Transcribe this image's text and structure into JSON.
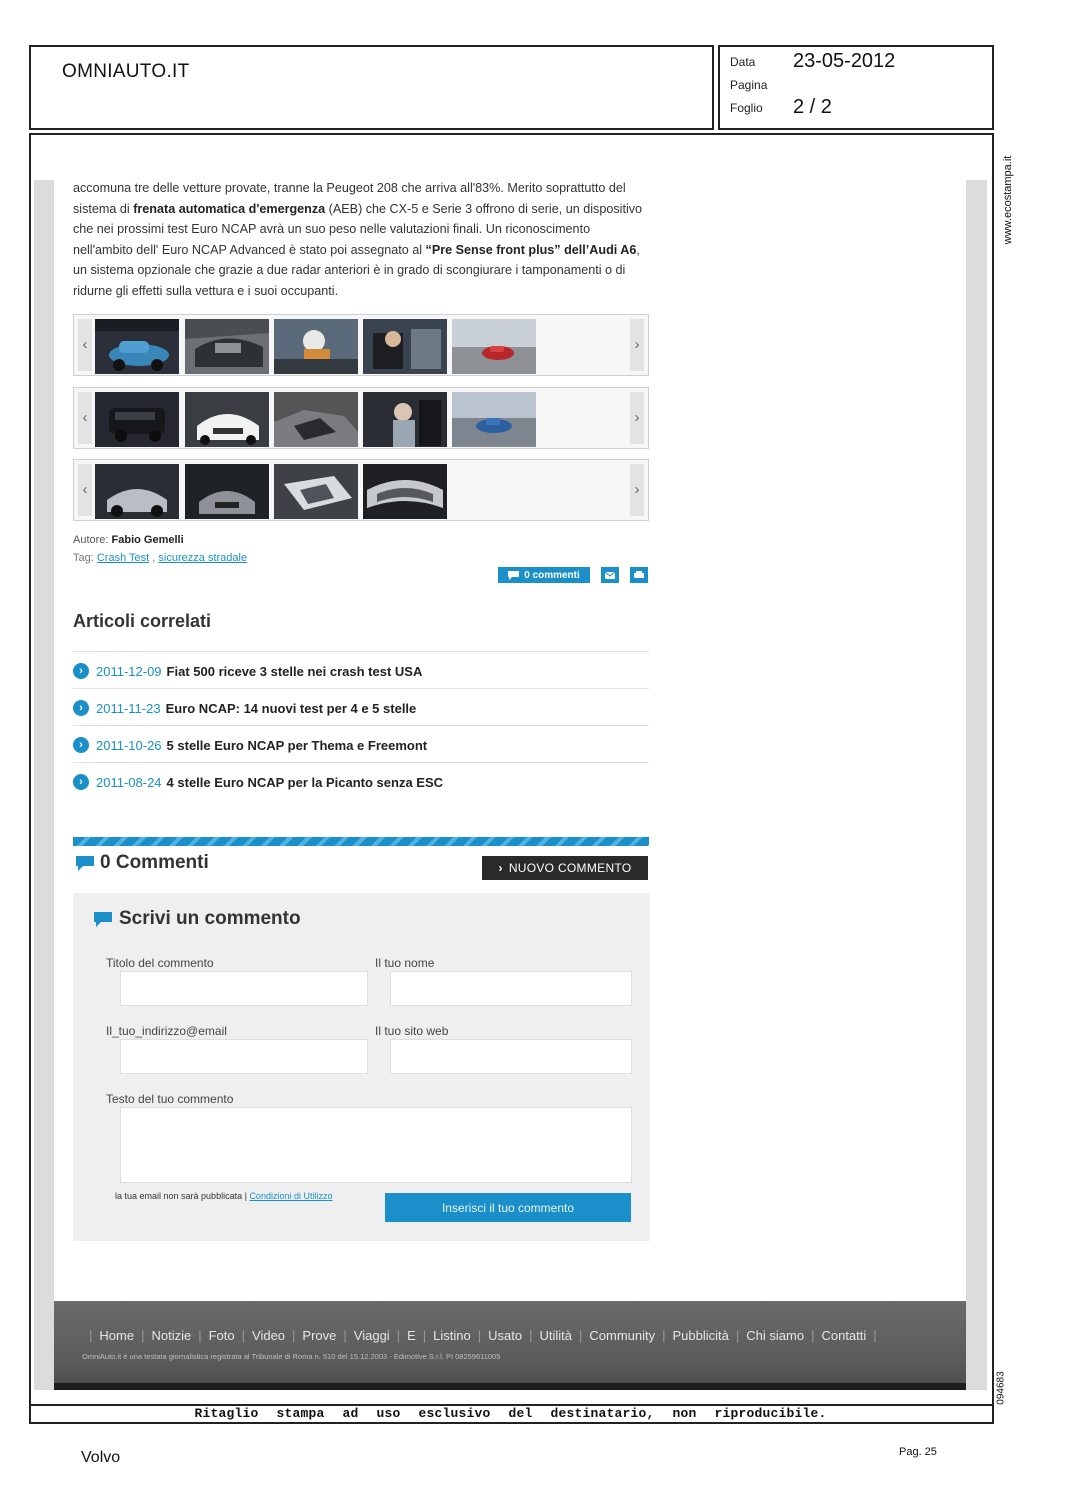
{
  "header": {
    "publication": "OMNIAUTO.IT",
    "date_label": "Data",
    "date_value": "23-05-2012",
    "page_label": "Pagina",
    "sheet_label": "Foglio",
    "sheet_value": "2 / 2"
  },
  "side": {
    "url": "www.ecostampa.it",
    "code": "094683"
  },
  "article": {
    "p1": "accomuna tre delle vetture provate, tranne la Peugeot 208 che arriva all'83%. Merito soprattutto del sistema di ",
    "b1": "frenata automatica d'emergenza",
    "p2": " (AEB) che CX-5 e Serie 3 offrono di serie, un dispositivo che nei prossimi test Euro NCAP avrà un suo peso nelle valutazioni finali. Un riconoscimento nell'ambito dell' Euro NCAP Advanced è stato poi assegnato al ",
    "b2": "“Pre Sense front plus” dell’Audi A6",
    "p3": ", un sistema opzionale che grazie a due radar anteriori è in grado di scongiurare i tamponamenti o di ridurne gli effetti sulla vettura e i suoi occupanti."
  },
  "gallery": {
    "left_arrow": "‹",
    "right_arrow": "›",
    "rows": [
      5,
      5,
      4
    ]
  },
  "meta": {
    "author_label": "Autore:",
    "author_name": "Fabio Gemelli",
    "tag_label": "Tag:",
    "tag1": "Crash Test",
    "tag_sep": " ,",
    "tag2": "sicurezza stradale",
    "comments_btn": "0 commenti"
  },
  "related": {
    "title": "Articoli correlati",
    "items": [
      {
        "date": "2011-12-09",
        "title": "Fiat 500 riceve 3 stelle nei crash test USA"
      },
      {
        "date": "2011-11-23",
        "title": "Euro NCAP: 14 nuovi test per 4 e 5 stelle"
      },
      {
        "date": "2011-10-26",
        "title": "5 stelle Euro NCAP per Thema e Freemont"
      },
      {
        "date": "2011-08-24",
        "title": "4 stelle Euro NCAP per la Picanto senza ESC"
      }
    ]
  },
  "comments": {
    "count_title": "0 Commenti",
    "new_btn": "NUOVO COMMENTO",
    "form_title": "Scrivi un commento",
    "label_title": "Titolo del commento",
    "label_name": "Il tuo nome",
    "label_email": "Il_tuo_indirizzo@email",
    "label_web": "Il tuo sito web",
    "label_text": "Testo del tuo commento",
    "privacy": "la tua email non sarà pubblicata |",
    "privacy_link": "Condizioni di Utilizzo",
    "submit": "Inserisci il tuo commento"
  },
  "footer": {
    "nav": [
      "Home",
      "Notizie",
      "Foto",
      "Video",
      "Prove",
      "Viaggi",
      "E",
      "Listino",
      "Usato",
      "Utilità",
      "Community",
      "Pubblicità",
      "Chi siamo",
      "Contatti"
    ],
    "legal": "OmniAuto.it è una testata giornalistica registrata al Tribunale di Roma n. 510 del 15.12.2003 - Edimotive S.r.l. PI 08259611005"
  },
  "page_footer": {
    "disclaimer": "Ritaglio stampa ad uso esclusivo del destinatario, non riproducibile.",
    "client": "Volvo",
    "page": "Pag. 25"
  },
  "colors": {
    "accent": "#1a8fc9",
    "footer_bg": "#5f5f5f",
    "sidebar": "#dcdcdc"
  }
}
